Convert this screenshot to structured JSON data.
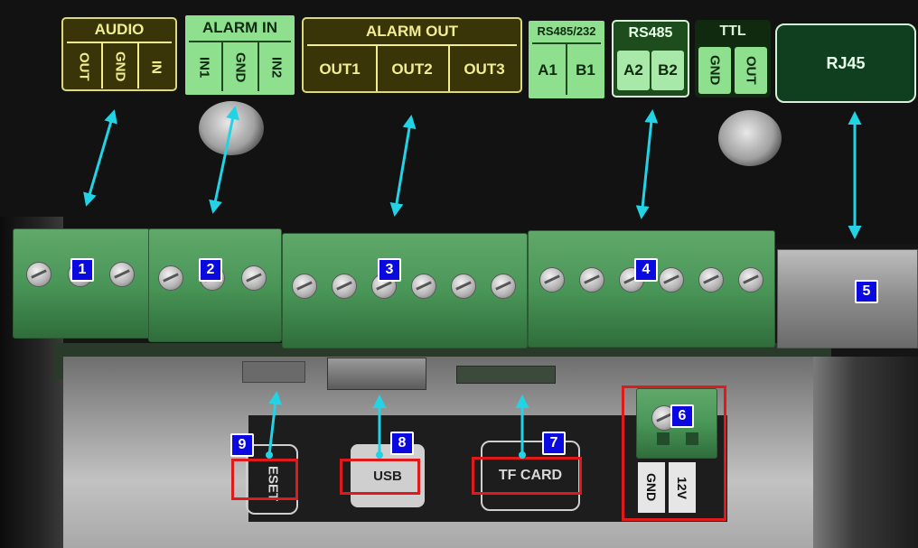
{
  "labels": {
    "audio": {
      "title": "AUDIO",
      "pins": [
        "OUT",
        "GND",
        "IN"
      ]
    },
    "alarm_in": {
      "title": "ALARM IN",
      "pins": [
        "IN1",
        "GND",
        "IN2"
      ]
    },
    "alarm_out": {
      "title": "ALARM OUT",
      "pins": [
        "OUT1",
        "OUT2",
        "OUT3"
      ]
    },
    "rs485_232": {
      "title": "RS485/232",
      "pins": [
        "A1",
        "B1"
      ]
    },
    "rs485": {
      "title": "RS485",
      "pins": [
        "A2",
        "B2"
      ]
    },
    "ttl": {
      "title": "TTL",
      "pins": [
        "GND",
        "OUT"
      ]
    },
    "rj45": {
      "title": "RJ45"
    }
  },
  "callouts": [
    "1",
    "2",
    "3",
    "4",
    "5",
    "6",
    "7",
    "8",
    "9"
  ],
  "bottom_labels": {
    "reset": "ESET",
    "usb": "USB",
    "tf_card": "TF CARD",
    "power_pins": [
      "GND",
      "12V"
    ]
  },
  "colors": {
    "arrow": "#22d3e6",
    "callout_badge": "#0a0ae0",
    "highlight_box": "#e01a1a",
    "terminal_green": "#4a9658"
  }
}
